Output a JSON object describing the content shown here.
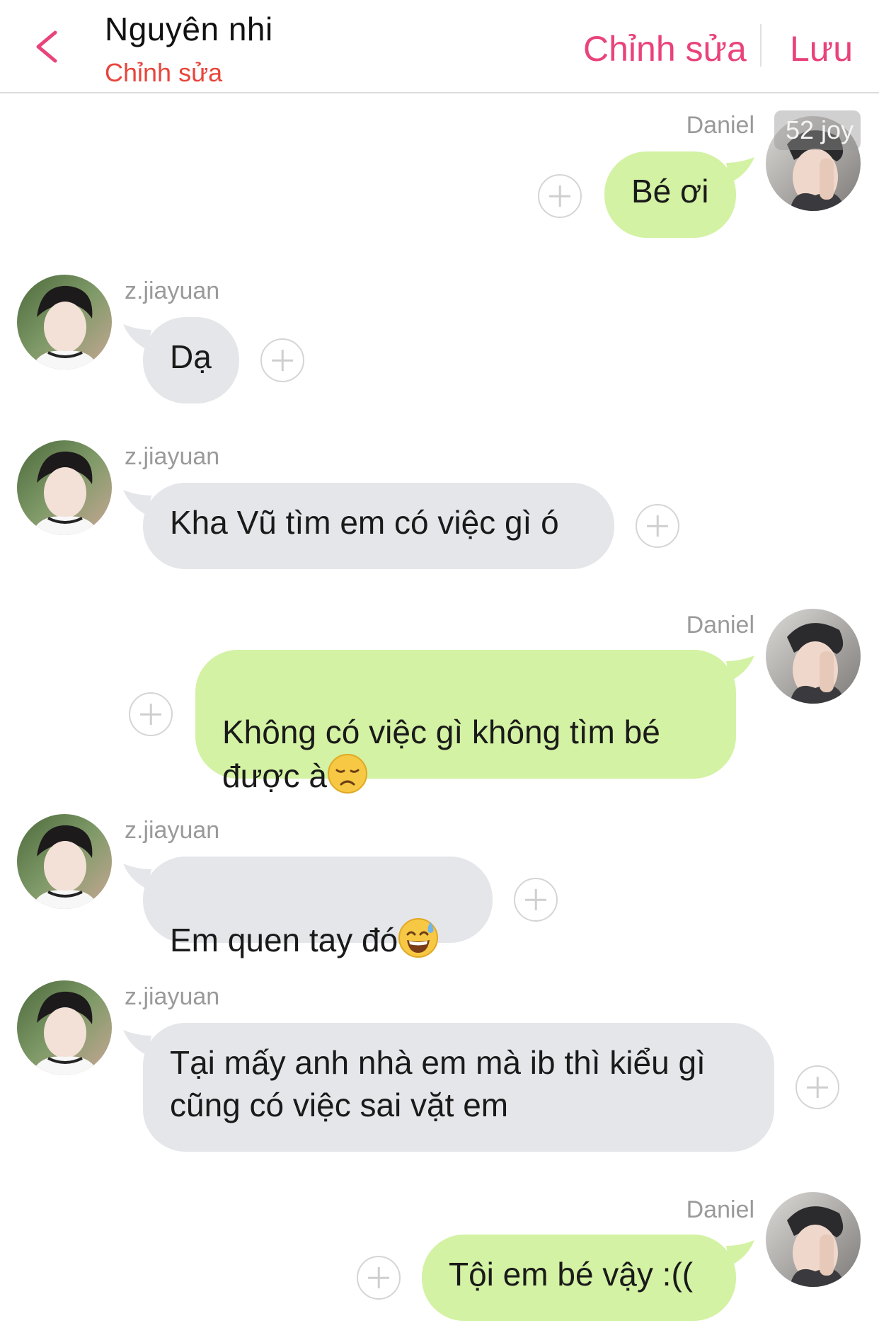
{
  "header": {
    "title": "Nguyên nhi",
    "subtitle": "Chỉnh sửa",
    "edit_label": "Chỉnh sửa",
    "save_label": "Lưu"
  },
  "watermark": "52 joy",
  "messages": [
    {
      "sender": "Daniel",
      "direction": "outgoing",
      "text": "Bé ơi"
    },
    {
      "sender": "z.jiayuan",
      "direction": "incoming",
      "text": "Dạ"
    },
    {
      "sender": "z.jiayuan",
      "direction": "incoming",
      "text": "Kha Vũ tìm em có việc gì ó"
    },
    {
      "sender": "Daniel",
      "direction": "outgoing",
      "text": "Không có việc gì không tìm bé\nđược à",
      "emoji": "disappointed-face"
    },
    {
      "sender": "z.jiayuan",
      "direction": "incoming",
      "text": "Em quen tay đó",
      "emoji": "grinning-face-with-sweat"
    },
    {
      "sender": "z.jiayuan",
      "direction": "incoming",
      "text": "Tại mấy anh nhà em mà ib thì kiểu gì\ncũng có việc sai vặt em"
    },
    {
      "sender": "Daniel",
      "direction": "outgoing",
      "text": "Tội em bé vậy :(("
    }
  ],
  "colors": {
    "accent": "#e9437a",
    "subtitle": "#e8453c",
    "incoming_bubble": "#e5e6ea",
    "outgoing_bubble": "#d3f2a3",
    "name_text": "#9a9a9a"
  },
  "icons": {
    "back": "chevron-left-icon",
    "add_reaction": "plus-circle-icon"
  }
}
